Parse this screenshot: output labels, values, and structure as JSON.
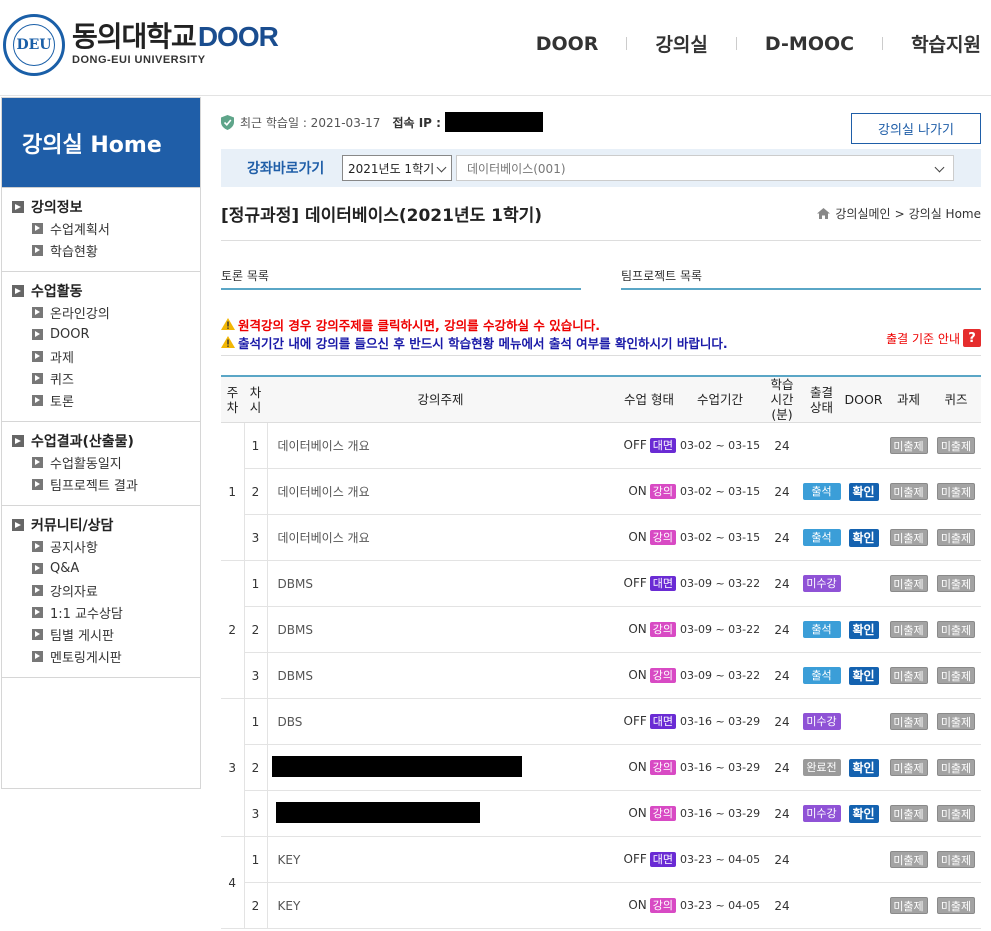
{
  "header": {
    "logo_seal_text": "DEU",
    "logo_title": "동의대학교",
    "logo_door": "DOOR",
    "logo_subtitle": "DONG-EUI UNIVERSITY",
    "nav": [
      "DOOR",
      "강의실",
      "D-MOOC",
      "학습지원"
    ]
  },
  "sidebar": {
    "title": "강의실 Home",
    "groups": [
      {
        "label": "강의정보",
        "items": [
          "수업계획서",
          "학습현황"
        ]
      },
      {
        "label": "수업활동",
        "items": [
          "온라인강의",
          "DOOR",
          "과제",
          "퀴즈",
          "토론"
        ]
      },
      {
        "label": "수업결과(산출물)",
        "items": [
          "수업활동일지",
          "팀프로젝트 결과"
        ]
      },
      {
        "label": "커뮤니티/상담",
        "items": [
          "공지사항",
          "Q&A",
          "강의자료",
          "1:1 교수상담",
          "팀별 게시판",
          "멘토링게시판"
        ]
      }
    ]
  },
  "info": {
    "recent_label": "최근 학습일 : 2021-03-17",
    "ip_label": "접속 IP :",
    "exit_button": "강의실 나가기"
  },
  "quick": {
    "label": "강좌바로가기",
    "term": "2021년도 1학기",
    "course": "데이터베이스(001)"
  },
  "course": {
    "title": "[정규과정] 데이터베이스(2021년도 1학기)",
    "breadcrumb_home": "강의실메인",
    "breadcrumb_sep": ">",
    "breadcrumb_current": "강의실 Home"
  },
  "lists": {
    "discussion": "토론 목록",
    "team_project": "팀프로젝트 목록"
  },
  "notice": {
    "line1": "원격강의 경우 강의주제를 클릭하시면, 강의를 수강하실 수 있습니다.",
    "line2": "출석기간 내에 강의를 들으신 후 반드시 학습현황 메뉴에서 출석 여부를 확인하시기 바랍니다.",
    "guide": "출결 기준 안내",
    "guide_icon": "?"
  },
  "table": {
    "headers": {
      "week": "주차",
      "cha": "차시",
      "topic": "강의주제",
      "mode": "수업 형태",
      "period": "수업기간",
      "time": "학습 시간(분)",
      "attend": "출결 상태",
      "door": "DOOR",
      "task": "과제",
      "quiz": "퀴즈"
    },
    "weeks": [
      {
        "week": "1",
        "rows": [
          {
            "cha": "1",
            "topic": "데이터베이스 개요",
            "mode": "OFF",
            "badge": "대면",
            "period": "03-02 ~ 03-15",
            "time": "24",
            "attend": "",
            "door": "",
            "task": "미출제",
            "quiz": "미출제"
          },
          {
            "cha": "2",
            "topic": "데이터베이스 개요",
            "mode": "ON",
            "badge": "강의",
            "period": "03-02 ~ 03-15",
            "time": "24",
            "attend": "출석",
            "door": "확인",
            "task": "미출제",
            "quiz": "미출제"
          },
          {
            "cha": "3",
            "topic": "데이터베이스 개요",
            "mode": "ON",
            "badge": "강의",
            "period": "03-02 ~ 03-15",
            "time": "24",
            "attend": "출석",
            "door": "확인",
            "task": "미출제",
            "quiz": "미출제"
          }
        ]
      },
      {
        "week": "2",
        "rows": [
          {
            "cha": "1",
            "topic": "DBMS",
            "mode": "OFF",
            "badge": "대면",
            "period": "03-09 ~ 03-22",
            "time": "24",
            "attend": "미수강",
            "door": "",
            "task": "미출제",
            "quiz": "미출제"
          },
          {
            "cha": "2",
            "topic": "DBMS",
            "mode": "ON",
            "badge": "강의",
            "period": "03-09 ~ 03-22",
            "time": "24",
            "attend": "출석",
            "door": "확인",
            "task": "미출제",
            "quiz": "미출제"
          },
          {
            "cha": "3",
            "topic": "DBMS",
            "mode": "ON",
            "badge": "강의",
            "period": "03-09 ~ 03-22",
            "time": "24",
            "attend": "출석",
            "door": "확인",
            "task": "미출제",
            "quiz": "미출제"
          }
        ]
      },
      {
        "week": "3",
        "rows": [
          {
            "cha": "1",
            "topic": "DBS",
            "mode": "OFF",
            "badge": "대면",
            "period": "03-16 ~ 03-29",
            "time": "24",
            "attend": "미수강",
            "door": "",
            "task": "미출제",
            "quiz": "미출제"
          },
          {
            "cha": "2",
            "topic": "",
            "mode": "ON",
            "badge": "강의",
            "period": "03-16 ~ 03-29",
            "time": "24",
            "attend": "완료전",
            "door": "확인",
            "task": "미출제",
            "quiz": "미출제"
          },
          {
            "cha": "3",
            "topic": "",
            "mode": "ON",
            "badge": "강의",
            "period": "03-16 ~ 03-29",
            "time": "24",
            "attend": "미수강",
            "door": "확인",
            "task": "미출제",
            "quiz": "미출제"
          }
        ]
      },
      {
        "week": "4",
        "rows": [
          {
            "cha": "1",
            "topic": "KEY",
            "mode": "OFF",
            "badge": "대면",
            "period": "03-23 ~ 04-05",
            "time": "24",
            "attend": "",
            "door": "",
            "task": "미출제",
            "quiz": "미출제"
          },
          {
            "cha": "2",
            "topic": "KEY",
            "mode": "ON",
            "badge": "강의",
            "period": "03-23 ~ 04-05",
            "time": "24",
            "attend": "",
            "door": "",
            "task": "미출제",
            "quiz": "미출제"
          }
        ]
      }
    ]
  },
  "colors": {
    "brand_blue": "#1f5ea8",
    "teal_line": "#5aa6c6",
    "attend_blue": "#3b9ed8",
    "missed_purple": "#8f52d6",
    "face_badge": "#6a2bd4",
    "online_badge": "#d84ac4",
    "door_confirm": "#1462b0"
  }
}
